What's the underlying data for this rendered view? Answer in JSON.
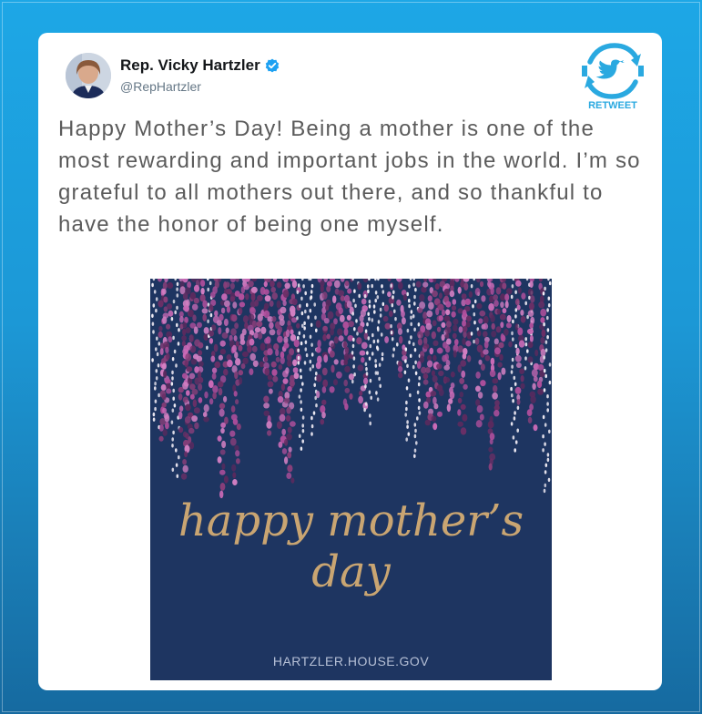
{
  "tweet": {
    "author_name": "Rep. Vicky Hartzler",
    "author_handle": "@RepHartzler",
    "text": "Happy Mother’s Day! Being a mother is one of the most rewarding and important jobs in the world. I’m so grateful to all mothers out there, and so thankful to have the honor of being one myself."
  },
  "retweet_badge": {
    "label": "RETWEET",
    "icon": "twitter-bird-icon"
  },
  "graphic": {
    "greeting_line1": "happy mother’s",
    "greeting_line2": "day",
    "website": "HARTZLER.HOUSE.GOV"
  },
  "colors": {
    "background": "#1da7e6",
    "card": "#ffffff",
    "graphic_bg": "#1e3561",
    "greeting_gold": "#c9a572",
    "verified_blue": "#1da1f2",
    "text_gray": "#5b5b5b"
  }
}
